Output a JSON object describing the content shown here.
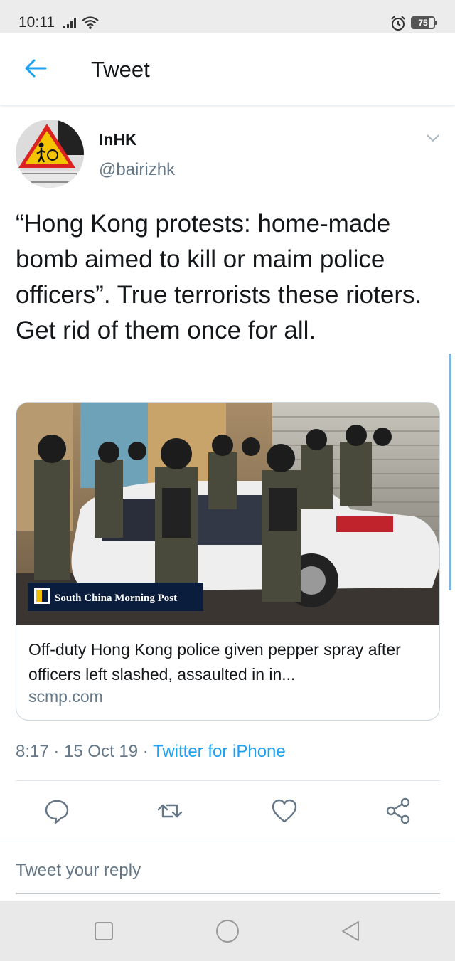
{
  "status_bar": {
    "time": "10:11",
    "battery": "75",
    "battery_level": 0.75,
    "icons": [
      "signal-icon",
      "wifi-icon",
      "alarm-icon",
      "battery-icon"
    ]
  },
  "header": {
    "title": "Tweet",
    "back_icon": "arrow-left-icon",
    "accent_color": "#1da1f2"
  },
  "tweet": {
    "author_name": "InHK",
    "author_handle": "@bairizhk",
    "text": "“Hong Kong protests: home-made bomb aimed to kill or maim police officers”. True terrorists these rioters. Get rid of them once for all.",
    "timestamp": "8:17 · 15 Oct 19 · ",
    "source": "Twitter for iPhone"
  },
  "card": {
    "publisher": "South China Morning Post",
    "title": "Off-duty Hong Kong police given pepper spray after officers left slashed, assaulted in in...",
    "domain": "scmp.com"
  },
  "actions": [
    {
      "name": "reply",
      "icon": "reply-icon"
    },
    {
      "name": "retweet",
      "icon": "retweet-icon"
    },
    {
      "name": "like",
      "icon": "heart-icon"
    },
    {
      "name": "share",
      "icon": "share-icon"
    }
  ],
  "reply_bar": {
    "placeholder": "Tweet your reply"
  },
  "nav_bar": {
    "buttons": [
      "recents-icon",
      "home-icon",
      "back-icon"
    ]
  }
}
